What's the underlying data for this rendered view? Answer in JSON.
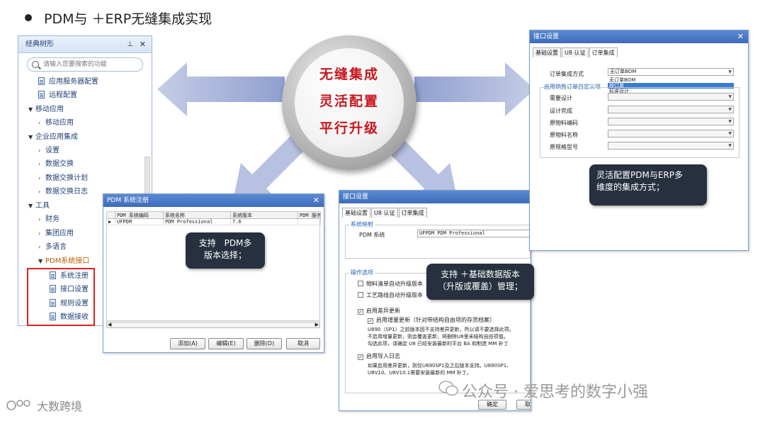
{
  "title": "PDM与 ＋ERP无缝集成实现",
  "circle": {
    "line1": "无缝集成",
    "line2": "灵活配置",
    "line3": "平行升级"
  },
  "tree": {
    "header": "经典树形",
    "pin": "📌",
    "close": "✕",
    "search_placeholder": "请输入您要搜索的功能",
    "items": [
      {
        "label": "应用服务器配置"
      },
      {
        "label": "远程配置"
      },
      {
        "label": "移动应用"
      },
      {
        "label": "移动应用"
      },
      {
        "label": "企业应用集成"
      },
      {
        "label": "设置"
      },
      {
        "label": "数据交换"
      },
      {
        "label": "数据交换计划"
      },
      {
        "label": "数据交换日志"
      },
      {
        "label": "工具"
      },
      {
        "label": "财务"
      },
      {
        "label": "集团应用"
      },
      {
        "label": "多语言"
      },
      {
        "label": "PDM系统接口"
      },
      {
        "label": "系统注册"
      },
      {
        "label": "接口设置"
      },
      {
        "label": "规则设置"
      },
      {
        "label": "数据接收"
      }
    ]
  },
  "pdm_window": {
    "title": "PDM 系统注册",
    "close": "✕",
    "columns": [
      "PDM 系统编码",
      "系统名称",
      "系统版本",
      "PDM 服务"
    ],
    "row": {
      "pointer": "▶",
      "code": "UFPDM",
      "name": "PDM Professional",
      "version": "7.6"
    },
    "scroll_left": "◀",
    "scroll_right": "▶",
    "buttons": {
      "add": "添加(A)",
      "edit": "编辑(E)",
      "delete": "删除(D)",
      "cancel": "取消"
    }
  },
  "callouts": {
    "pdm_version": "支持　PDM多\n版本选择；",
    "base_data": "支持 ＋基础数据版本\n（升版或覆盖）管理；",
    "flexible": "灵活配置PDM与ERP多\n维度的集成方式；"
  },
  "if_mid": {
    "title": "接口设置",
    "close": "✕",
    "tabs": [
      "基础设置",
      "U8 认证",
      "订单集成"
    ],
    "group_mapping": "系统映射",
    "pdm_system_label": "PDM 系统",
    "pdm_system_value": "UFPDM PDM Professional",
    "group_options": "操作选项",
    "opt1": "物料清单自动升级版本",
    "opt2": "工艺路线自动升级版本",
    "opt3": "启用差异更新",
    "opt3_sub": "启用增量更新（针对带结构自由项的存货档案）",
    "note1": "U890（SP1）之前版本因不支持差异更新，所以请不要选择此项。",
    "note2": "不启用增量更新，则会覆盖更新，将删除U8里未结构自由项值。",
    "note3": "勾选此项，请确定 U8 已经安装最新的平台 BA 和制造 MM 补丁",
    "opt4": "启用导入日志",
    "note4": "如果启用差异更新，则仅U890SP1及之后版本支持。U890SP1、",
    "note5": "U8V10、U8V10.1需要安装最新的 MM 补丁。",
    "check_mark": "✓",
    "ok": "确定",
    "cancel": "取消"
  },
  "if_right": {
    "title": "接口设置",
    "close": "✕",
    "tabs": [
      "基础设置",
      "U8 认证",
      "订单集成"
    ],
    "order_mode_label": "订单集成方式",
    "order_mode_value": "无订单BOM",
    "dd_options": [
      "无订单BOM",
      "按订单",
      "标准设计"
    ],
    "group_label": "启用销售订单自定义项",
    "fields": [
      "需要设计",
      "设计完成",
      "原物料编码",
      "原物料名称",
      "原规格型号"
    ],
    "ok": "确定",
    "cancel": "取消"
  },
  "watermarks": {
    "left": "大数跨境",
    "right": "公众号 · 爱思考的数字小强"
  },
  "colors": {
    "title_blue": "#3d6bbb",
    "circle_red": "#c8161d",
    "callout_bg": "#27303f",
    "arrow": "#aab6d8"
  }
}
